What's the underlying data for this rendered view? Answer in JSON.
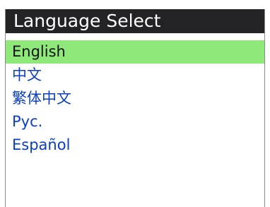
{
  "window": {
    "title": "Language Select"
  },
  "languages": [
    {
      "label": "English",
      "selected": true
    },
    {
      "label": "中文",
      "selected": false
    },
    {
      "label": "繁体中文",
      "selected": false
    },
    {
      "label": "Рус.",
      "selected": false
    },
    {
      "label": "Español",
      "selected": false
    }
  ],
  "colors": {
    "title_bg": "#232326",
    "selected_bg": "#8ee87a",
    "item_text": "#0b3fbf"
  }
}
